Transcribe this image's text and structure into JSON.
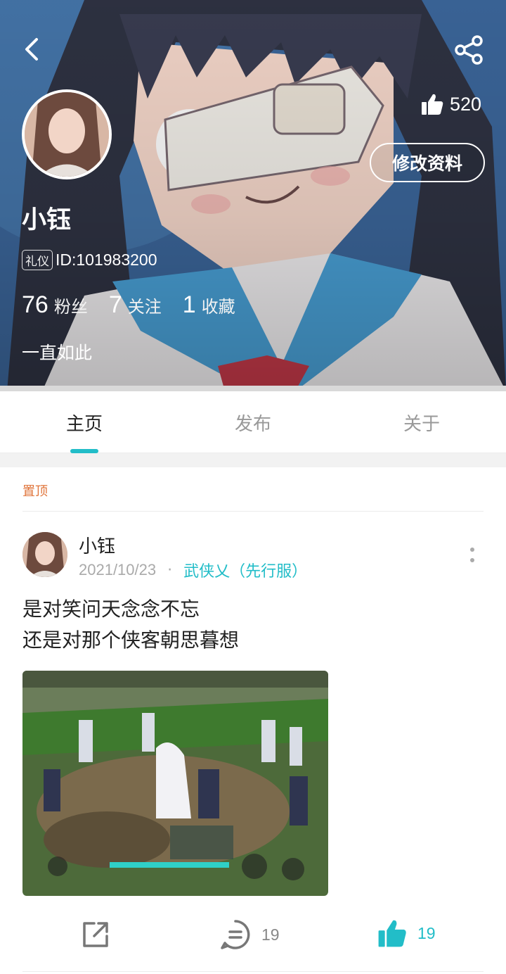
{
  "profile": {
    "name": "小钰",
    "badge": "礼仪",
    "id_text": "ID:101983200",
    "likes": "520",
    "edit_label": "修改资料",
    "stats": [
      {
        "num": "76",
        "label": "粉丝"
      },
      {
        "num": "7",
        "label": "关注"
      },
      {
        "num": "1",
        "label": "收藏"
      }
    ],
    "bio": "一直如此"
  },
  "tabs": [
    {
      "label": "主页",
      "active": true
    },
    {
      "label": "发布",
      "active": false
    },
    {
      "label": "关于",
      "active": false
    }
  ],
  "feed": {
    "pinned_label": "置顶",
    "post": {
      "author": "小钰",
      "date": "2021/10/23",
      "dot": "·",
      "game": "武侠乂（先行服）",
      "lines": [
        "是对笑问天念念不忘",
        "还是对那个侠客朝思暮想"
      ],
      "comment_count": "19",
      "like_count": "19"
    }
  },
  "colors": {
    "accent": "#22bdc8",
    "pinned": "#e0743a"
  },
  "icons": {
    "back": "chevron-left-icon",
    "share": "share-icon",
    "like": "thumbs-up-icon",
    "more": "more-vertical-icon",
    "forward": "external-share-icon",
    "comment": "comment-icon"
  }
}
